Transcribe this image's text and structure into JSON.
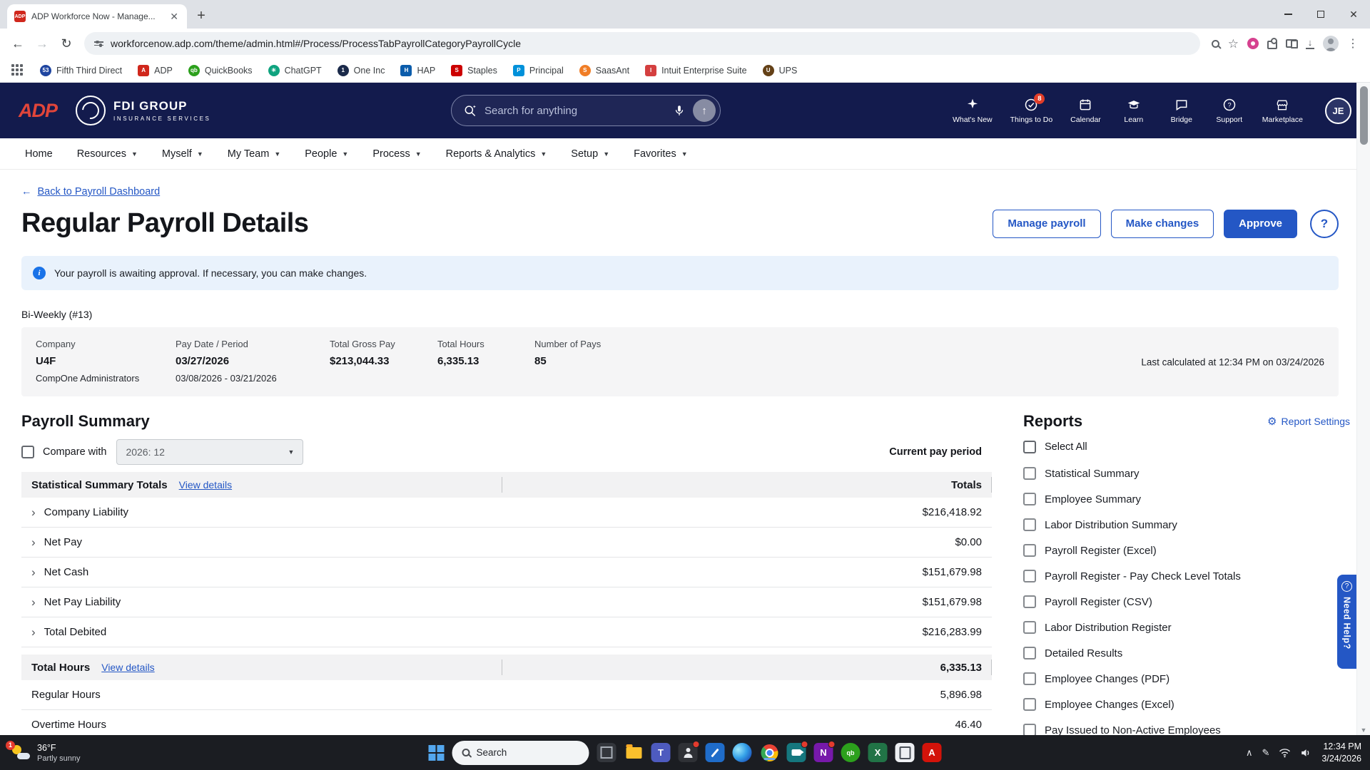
{
  "colors": {
    "navy": "#131b4d",
    "adp_red": "#d0271c",
    "accent_blue": "#2457c5",
    "banner_bg": "#e9f2fc"
  },
  "browser": {
    "tab_title": "ADP Workforce Now - Manage...",
    "url": "workforcenow.adp.com/theme/admin.html#/Process/ProcessTabPayrollCategoryPayrollCycle",
    "bookmarks": [
      "Fifth Third Direct",
      "ADP",
      "QuickBooks",
      "ChatGPT",
      "One Inc",
      "HAP",
      "Staples",
      "Principal",
      "SaasAnt",
      "Intuit Enterprise Suite",
      "UPS"
    ]
  },
  "header": {
    "logo": "ADP",
    "company_name": "FDI GROUP",
    "company_tagline": "INSURANCE SERVICES",
    "search_placeholder": "Search for anything",
    "utilities": [
      {
        "label": "What's New"
      },
      {
        "label": "Things to Do",
        "badge": "8"
      },
      {
        "label": "Calendar"
      },
      {
        "label": "Learn"
      },
      {
        "label": "Bridge"
      },
      {
        "label": "Support"
      },
      {
        "label": "Marketplace"
      }
    ],
    "avatar": "JE"
  },
  "nav": {
    "items": [
      "Home",
      "Resources",
      "Myself",
      "My Team",
      "People",
      "Process",
      "Reports & Analytics",
      "Setup",
      "Favorites"
    ]
  },
  "page": {
    "back_link": "Back to Payroll Dashboard",
    "title": "Regular Payroll Details",
    "actions": {
      "manage": "Manage payroll",
      "make_changes": "Make changes",
      "approve": "Approve",
      "help": "?"
    },
    "banner_text": "Your payroll is awaiting approval. If necessary, you can make changes.",
    "cycle_label": "Bi-Weekly (#13)",
    "summary": {
      "company_label": "Company",
      "company": "U4F",
      "company_sub": "CompOne Administrators",
      "period_label": "Pay Date / Period",
      "pay_date": "03/27/2026",
      "period": "03/08/2026 - 03/21/2026",
      "gross_label": "Total Gross Pay",
      "gross": "$213,044.33",
      "hours_label": "Total Hours",
      "hours": "6,335.13",
      "pays_label": "Number of Pays",
      "pays": "85",
      "last_calculated": "Last calculated at 12:34 PM on 03/24/2026"
    },
    "payroll_summary": {
      "heading": "Payroll Summary",
      "compare_label": "Compare with",
      "compare_value": "2026: 12",
      "current_period_label": "Current pay period",
      "table_heading": "Statistical Summary Totals",
      "view_details": "View details",
      "totals_label": "Totals",
      "rows": [
        {
          "label": "Company Liability",
          "value": "$216,418.92"
        },
        {
          "label": "Net Pay",
          "value": "$0.00"
        },
        {
          "label": "Net Cash",
          "value": "$151,679.98"
        },
        {
          "label": "Net Pay Liability",
          "value": "$151,679.98"
        },
        {
          "label": "Total Debited",
          "value": "$216,283.99"
        }
      ],
      "hours_heading": "Total Hours",
      "hours_total": "6,335.13",
      "hours_rows": [
        {
          "label": "Regular Hours",
          "value": "5,896.98"
        },
        {
          "label": "Overtime Hours",
          "value": "46.40"
        }
      ]
    },
    "reports": {
      "heading": "Reports",
      "settings_label": "Report Settings",
      "select_all": "Select All",
      "items": [
        "Statistical Summary",
        "Employee Summary",
        "Labor Distribution Summary",
        "Payroll Register (Excel)",
        "Payroll Register - Pay Check Level Totals",
        "Payroll Register (CSV)",
        "Labor Distribution Register",
        "Detailed Results",
        "Employee Changes (PDF)",
        "Employee Changes (Excel)",
        "Pay Issued to Non-Active Employees"
      ]
    },
    "need_help": "Need Help?"
  },
  "taskbar": {
    "weather_temp": "36°F",
    "weather_desc": "Partly sunny",
    "weather_badge": "1",
    "search_placeholder": "Search",
    "time": "12:34 PM",
    "date": "3/24/2026"
  }
}
